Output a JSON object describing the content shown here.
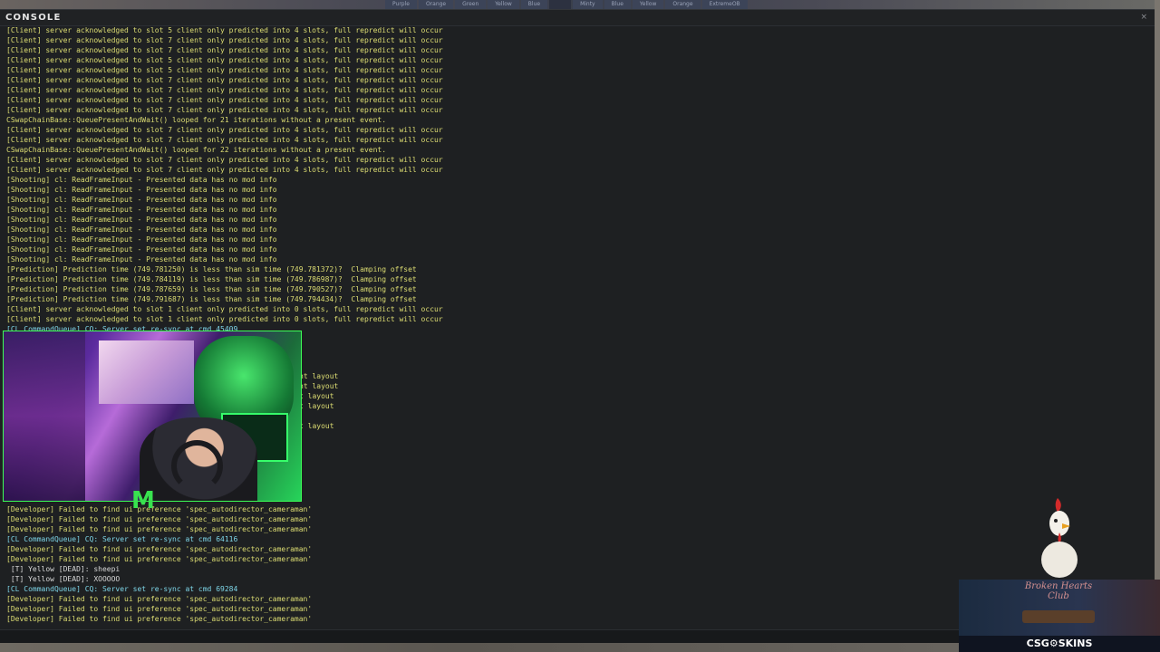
{
  "hud": {
    "tabs": [
      "Purple",
      "Orange",
      "Green",
      "Yellow",
      "Blue",
      "",
      "Minty",
      "Blue",
      "Yellow",
      "Orange",
      "ExtremeOB"
    ]
  },
  "console": {
    "title": "CONSOLE",
    "close_icon": "×",
    "lines": [
      {
        "text": "[Client] server acknowledged to slot 5 client only predicted into 4 slots, full repredict will occur",
        "kind": "client"
      },
      {
        "text": "[Client] server acknowledged to slot 7 client only predicted into 4 slots, full repredict will occur",
        "kind": "client"
      },
      {
        "text": "[Client] server acknowledged to slot 7 client only predicted into 4 slots, full repredict will occur",
        "kind": "client"
      },
      {
        "text": "[Client] server acknowledged to slot 5 client only predicted into 4 slots, full repredict will occur",
        "kind": "client"
      },
      {
        "text": "[Client] server acknowledged to slot 5 client only predicted into 4 slots, full repredict will occur",
        "kind": "client"
      },
      {
        "text": "[Client] server acknowledged to slot 7 client only predicted into 4 slots, full repredict will occur",
        "kind": "client"
      },
      {
        "text": "[Client] server acknowledged to slot 7 client only predicted into 4 slots, full repredict will occur",
        "kind": "client"
      },
      {
        "text": "[Client] server acknowledged to slot 7 client only predicted into 4 slots, full repredict will occur",
        "kind": "client"
      },
      {
        "text": "[Client] server acknowledged to slot 7 client only predicted into 4 slots, full repredict will occur",
        "kind": "client"
      },
      {
        "text": "CSwapChainBase::QueuePresentAndWait() looped for 21 iterations without a present event.",
        "kind": "swap"
      },
      {
        "text": "[Client] server acknowledged to slot 7 client only predicted into 4 slots, full repredict will occur",
        "kind": "client"
      },
      {
        "text": "[Client] server acknowledged to slot 7 client only predicted into 4 slots, full repredict will occur",
        "kind": "client"
      },
      {
        "text": "CSwapChainBase::QueuePresentAndWait() looped for 22 iterations without a present event.",
        "kind": "swap"
      },
      {
        "text": "[Client] server acknowledged to slot 7 client only predicted into 4 slots, full repredict will occur",
        "kind": "client"
      },
      {
        "text": "[Client] server acknowledged to slot 7 client only predicted into 4 slots, full repredict will occur",
        "kind": "client"
      },
      {
        "text": "[Shooting] cl: ReadFrameInput - Presented data has no mod info",
        "kind": "shoot"
      },
      {
        "text": "[Shooting] cl: ReadFrameInput - Presented data has no mod info",
        "kind": "shoot"
      },
      {
        "text": "[Shooting] cl: ReadFrameInput - Presented data has no mod info",
        "kind": "shoot"
      },
      {
        "text": "[Shooting] cl: ReadFrameInput - Presented data has no mod info",
        "kind": "shoot"
      },
      {
        "text": "[Shooting] cl: ReadFrameInput - Presented data has no mod info",
        "kind": "shoot"
      },
      {
        "text": "[Shooting] cl: ReadFrameInput - Presented data has no mod info",
        "kind": "shoot"
      },
      {
        "text": "[Shooting] cl: ReadFrameInput - Presented data has no mod info",
        "kind": "shoot"
      },
      {
        "text": "[Shooting] cl: ReadFrameInput - Presented data has no mod info",
        "kind": "shoot"
      },
      {
        "text": "[Shooting] cl: ReadFrameInput - Presented data has no mod info",
        "kind": "shoot"
      },
      {
        "text": "[Prediction] Prediction time (749.781250) is less than sim time (749.781372)?  Clamping offset",
        "kind": "pred"
      },
      {
        "text": "[Prediction] Prediction time (749.784119) is less than sim time (749.786987)?  Clamping offset",
        "kind": "pred"
      },
      {
        "text": "[Prediction] Prediction time (749.787659) is less than sim time (749.790527)?  Clamping offset",
        "kind": "pred"
      },
      {
        "text": "[Prediction] Prediction time (749.791687) is less than sim time (749.794434)?  Clamping offset",
        "kind": "pred"
      },
      {
        "text": "[Client] server acknowledged to slot 1 client only predicted into 0 slots, full repredict will occur",
        "kind": "client"
      },
      {
        "text": "[Client] server acknowledged to slot 1 client only predicted into 0 slots, full repredict will occur",
        "kind": "client"
      },
      {
        "text": "[CL CommandQueue] CQ: Server set re-sync at cmd 45409",
        "kind": "cq"
      }
    ],
    "fragments": [
      "ht layout",
      "ht layout",
      "t layout",
      "t layout",
      "",
      "t layout"
    ],
    "lower_lines": [
      {
        "text": "[Developer] Failed to find ui preference 'spec_autodirector_cameraman'",
        "kind": "dev"
      },
      {
        "text": "[Developer] Failed to find ui preference 'spec_autodirector_cameraman'",
        "kind": "dev"
      },
      {
        "text": "[Developer] Failed to find ui preference 'spec_autodirector_cameraman'",
        "kind": "dev"
      },
      {
        "text": "[CL CommandQueue] CQ: Server set re-sync at cmd 64116",
        "kind": "cq"
      },
      {
        "text": "[Developer] Failed to find ui preference 'spec_autodirector_cameraman'",
        "kind": "dev"
      },
      {
        "text": "[Developer] Failed to find ui preference 'spec_autodirector_cameraman'",
        "kind": "dev"
      },
      {
        "text": " [T] Yellow [DEAD]: sheepi",
        "kind": "team"
      },
      {
        "text": " [T] Yellow [DEAD]: XOOOOO",
        "kind": "team"
      },
      {
        "text": "[CL CommandQueue] CQ: Server set re-sync at cmd 69284",
        "kind": "cq"
      },
      {
        "text": "[Developer] Failed to find ui preference 'spec_autodirector_cameraman'",
        "kind": "dev"
      },
      {
        "text": "[Developer] Failed to find ui preference 'spec_autodirector_cameraman'",
        "kind": "dev"
      },
      {
        "text": "[Developer] Failed to find ui preference 'spec_autodirector_cameraman'",
        "kind": "dev"
      }
    ]
  },
  "webcam": {
    "logo": "M"
  },
  "sponsor": {
    "club": "Broken Hearts Club",
    "brand": "CSG⚙SKINS"
  },
  "colors": {
    "client": "#dcdc72",
    "cq": "#7ed6e8",
    "team": "#d8d8d8",
    "cam_border": "#3cff56"
  }
}
